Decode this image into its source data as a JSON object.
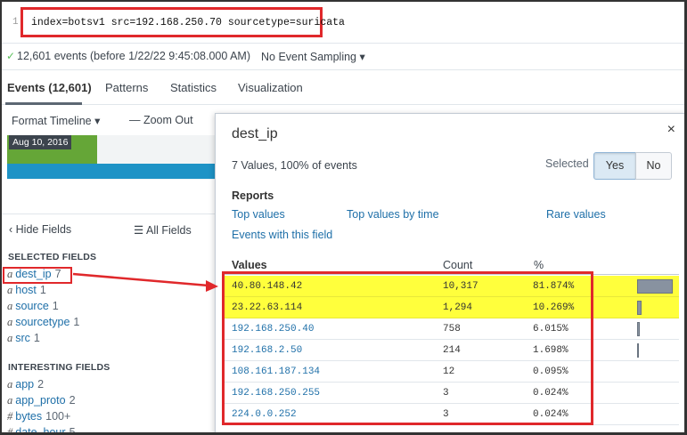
{
  "search": {
    "line_number": "1",
    "query": "index=botsv1 src=192.168.250.70 sourcetype=suricata"
  },
  "status": {
    "events_text": "12,601 events (before 1/22/22 9:45:08.000 AM)",
    "sampling_label": "No Event Sampling ▾"
  },
  "tabs": [
    {
      "label": "Events (12,601)"
    },
    {
      "label": "Patterns"
    },
    {
      "label": "Statistics"
    },
    {
      "label": "Visualization"
    }
  ],
  "timeline": {
    "format_label": "Format Timeline ▾",
    "zoom_label": "— Zoom Out",
    "date_label": "Aug 10, 2016"
  },
  "sidebar": {
    "hide_fields": "‹ Hide Fields",
    "all_fields": "☰ All Fields",
    "selected_heading": "SELECTED FIELDS",
    "selected": [
      {
        "type": "a",
        "name": "dest_ip",
        "count": "7"
      },
      {
        "type": "a",
        "name": "host",
        "count": "1"
      },
      {
        "type": "a",
        "name": "source",
        "count": "1"
      },
      {
        "type": "a",
        "name": "sourcetype",
        "count": "1"
      },
      {
        "type": "a",
        "name": "src",
        "count": "1"
      }
    ],
    "interesting_heading": "INTERESTING FIELDS",
    "interesting": [
      {
        "type": "a",
        "name": "app",
        "count": "2"
      },
      {
        "type": "a",
        "name": "app_proto",
        "count": "2"
      },
      {
        "type": "#",
        "name": "bytes",
        "count": "100+"
      },
      {
        "type": "#",
        "name": "date_hour",
        "count": "5"
      }
    ]
  },
  "panel": {
    "title": "dest_ip",
    "close": "×",
    "subtitle": "7 Values, 100% of events",
    "selected_label": "Selected",
    "yes": "Yes",
    "no": "No",
    "reports_title": "Reports",
    "reports": {
      "top_values": "Top values",
      "top_values_by_time": "Top values by time",
      "rare_values": "Rare values",
      "events_with_field": "Events with this field"
    },
    "columns": {
      "values": "Values",
      "count": "Count",
      "percent": "%"
    },
    "rows": [
      {
        "value": "40.80.148.42",
        "count": "10,317",
        "percent": "81.874%",
        "fraction": 0.81874,
        "highlight": true
      },
      {
        "value": "23.22.63.114",
        "count": "1,294",
        "percent": "10.269%",
        "fraction": 0.10269,
        "highlight": true
      },
      {
        "value": "192.168.250.40",
        "count": "758",
        "percent": "6.015%",
        "fraction": 0.06015,
        "highlight": false
      },
      {
        "value": "192.168.2.50",
        "count": "214",
        "percent": "1.698%",
        "fraction": 0.01698,
        "highlight": false
      },
      {
        "value": "108.161.187.134",
        "count": "12",
        "percent": "0.095%",
        "fraction": 0.00095,
        "highlight": false
      },
      {
        "value": "192.168.250.255",
        "count": "3",
        "percent": "0.024%",
        "fraction": 0.00024,
        "highlight": false
      },
      {
        "value": "224.0.0.252",
        "count": "3",
        "percent": "0.024%",
        "fraction": 0.00024,
        "highlight": false
      }
    ]
  },
  "colors": {
    "annotation_red": "#e0282b",
    "highlight_yellow": "#ffff3c",
    "link_blue": "#1e6fa8",
    "timeline_green": "#65a637",
    "timeline_blue": "#1e93c6"
  }
}
